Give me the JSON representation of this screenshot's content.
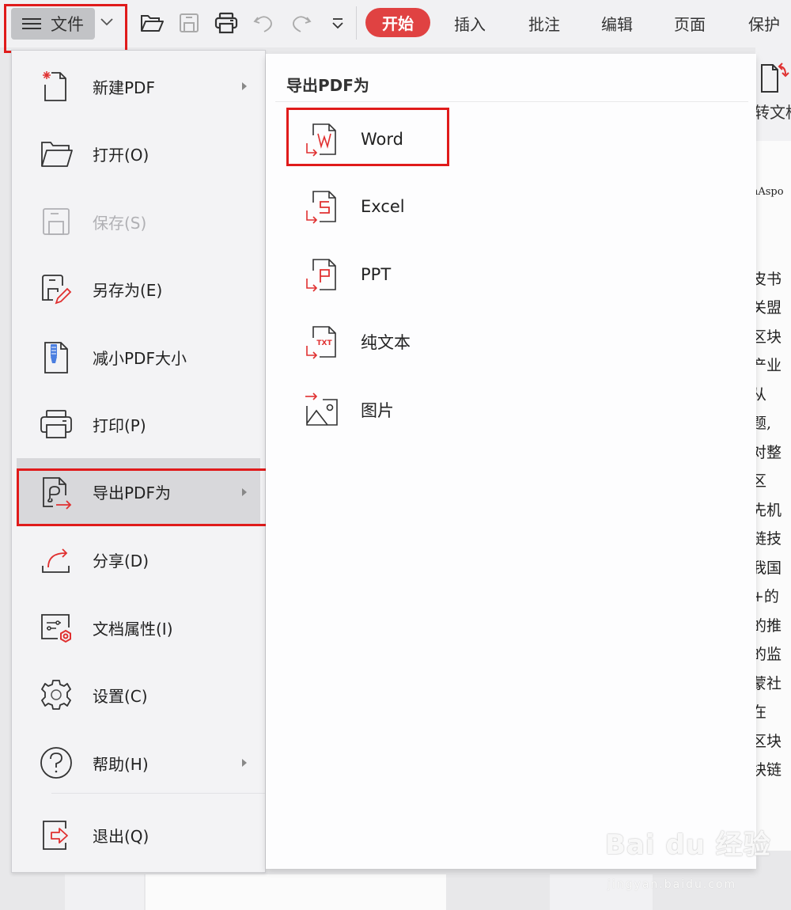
{
  "toolbar": {
    "file_menu_label": "文件",
    "quick_icons": [
      "folder-open-icon",
      "save-icon",
      "print-icon",
      "undo-icon",
      "redo-icon",
      "customize-dropdown-icon"
    ],
    "tabs": [
      {
        "label": "开始",
        "active": true
      },
      {
        "label": "插入",
        "active": false
      },
      {
        "label": "批注",
        "active": false
      },
      {
        "label": "编辑",
        "active": false
      },
      {
        "label": "页面",
        "active": false
      },
      {
        "label": "保护",
        "active": false
      }
    ],
    "accent_color": "#e04242"
  },
  "ribbon_partial": {
    "label": "转文档"
  },
  "file_menu": {
    "items": [
      {
        "label": "新建PDF",
        "icon": "new-pdf-icon",
        "submenu": true,
        "disabled": false
      },
      {
        "label": "打开(O)",
        "icon": "folder-open-icon",
        "submenu": false,
        "disabled": false
      },
      {
        "label": "保存(S)",
        "icon": "save-icon",
        "submenu": false,
        "disabled": true
      },
      {
        "label": "另存为(E)",
        "icon": "save-as-icon",
        "submenu": false,
        "disabled": false
      },
      {
        "label": "减小PDF大小",
        "icon": "compress-pdf-icon",
        "submenu": false,
        "disabled": false
      },
      {
        "label": "打印(P)",
        "icon": "print-icon",
        "submenu": false,
        "disabled": false
      },
      {
        "label": "导出PDF为",
        "icon": "export-pdf-icon",
        "submenu": true,
        "disabled": false,
        "active": true
      },
      {
        "label": "分享(D)",
        "icon": "share-icon",
        "submenu": false,
        "disabled": false
      },
      {
        "label": "文档属性(I)",
        "icon": "document-properties-icon",
        "submenu": false,
        "disabled": false
      },
      {
        "label": "设置(C)",
        "icon": "settings-gear-icon",
        "submenu": false,
        "disabled": false
      },
      {
        "label": "帮助(H)",
        "icon": "help-icon",
        "submenu": true,
        "disabled": false
      },
      {
        "label": "退出(Q)",
        "icon": "exit-icon",
        "submenu": false,
        "disabled": false
      }
    ]
  },
  "export_submenu": {
    "title": "导出PDF为",
    "items": [
      {
        "label": "Word",
        "icon": "export-word-icon",
        "highlighted": true
      },
      {
        "label": "Excel",
        "icon": "export-excel-icon",
        "highlighted": false
      },
      {
        "label": "PPT",
        "icon": "export-ppt-icon",
        "highlighted": false
      },
      {
        "label": "纯文本",
        "icon": "export-txt-icon",
        "highlighted": false
      },
      {
        "label": "图片",
        "icon": "export-image-icon",
        "highlighted": false
      }
    ]
  },
  "document_fragment": {
    "lines": [
      "nAspo",
      "",
      "",
      "皮书",
      "关盟",
      "区块",
      "产业",
      "从",
      "题,",
      "对整",
      "区",
      "先机",
      "链技",
      "我国",
      "+的",
      "的推",
      "的监",
      "蒙社",
      "在",
      "区块",
      "块链"
    ]
  },
  "watermark": {
    "brand": "Bai du 经验",
    "sub": "jingyan.baidu.com"
  }
}
